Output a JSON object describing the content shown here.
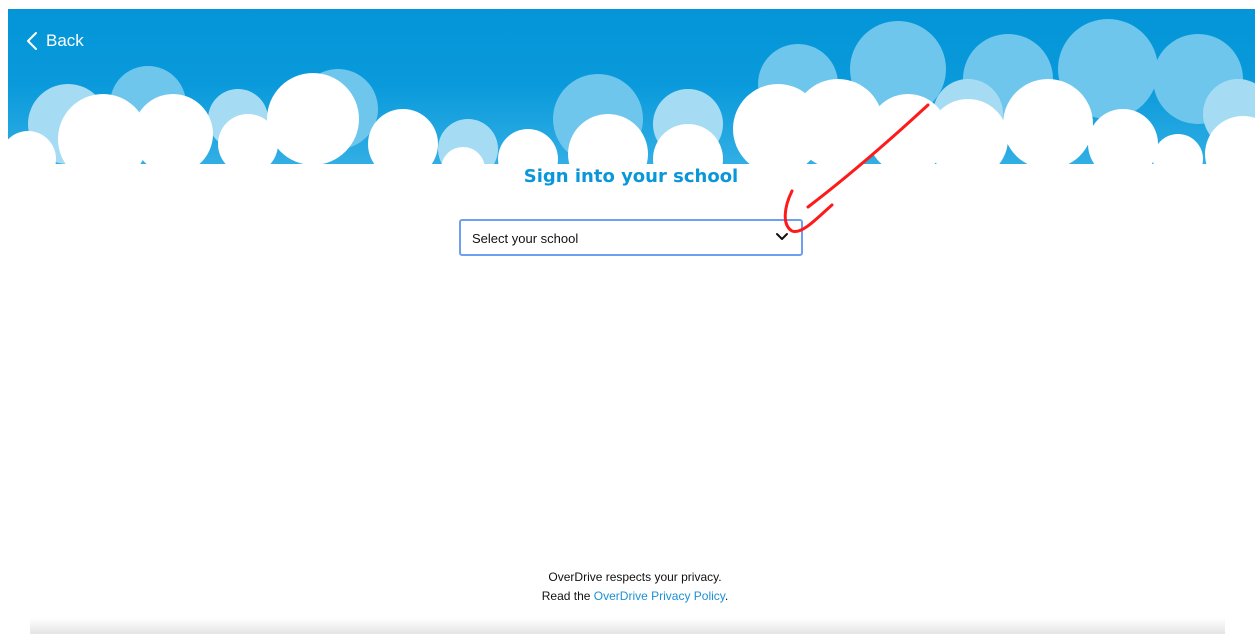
{
  "header": {
    "back_label": "Back"
  },
  "main": {
    "title": "Sign into your school",
    "school_select": {
      "selected_value": "Select your school"
    }
  },
  "footer": {
    "line1": "OverDrive respects your privacy.",
    "line2_prefix": "Read the ",
    "privacy_link": "OverDrive Privacy Policy",
    "line2_suffix": "."
  },
  "colors": {
    "sky_blue": "#0a97d9",
    "title_blue": "#0a97d9",
    "focus_ring": "#6e9ff3",
    "link_blue": "#1c8fd6",
    "annotation_red": "#ff1a1a"
  },
  "icons": {
    "back": "chevron-left-icon",
    "select": "chevron-down-icon"
  }
}
